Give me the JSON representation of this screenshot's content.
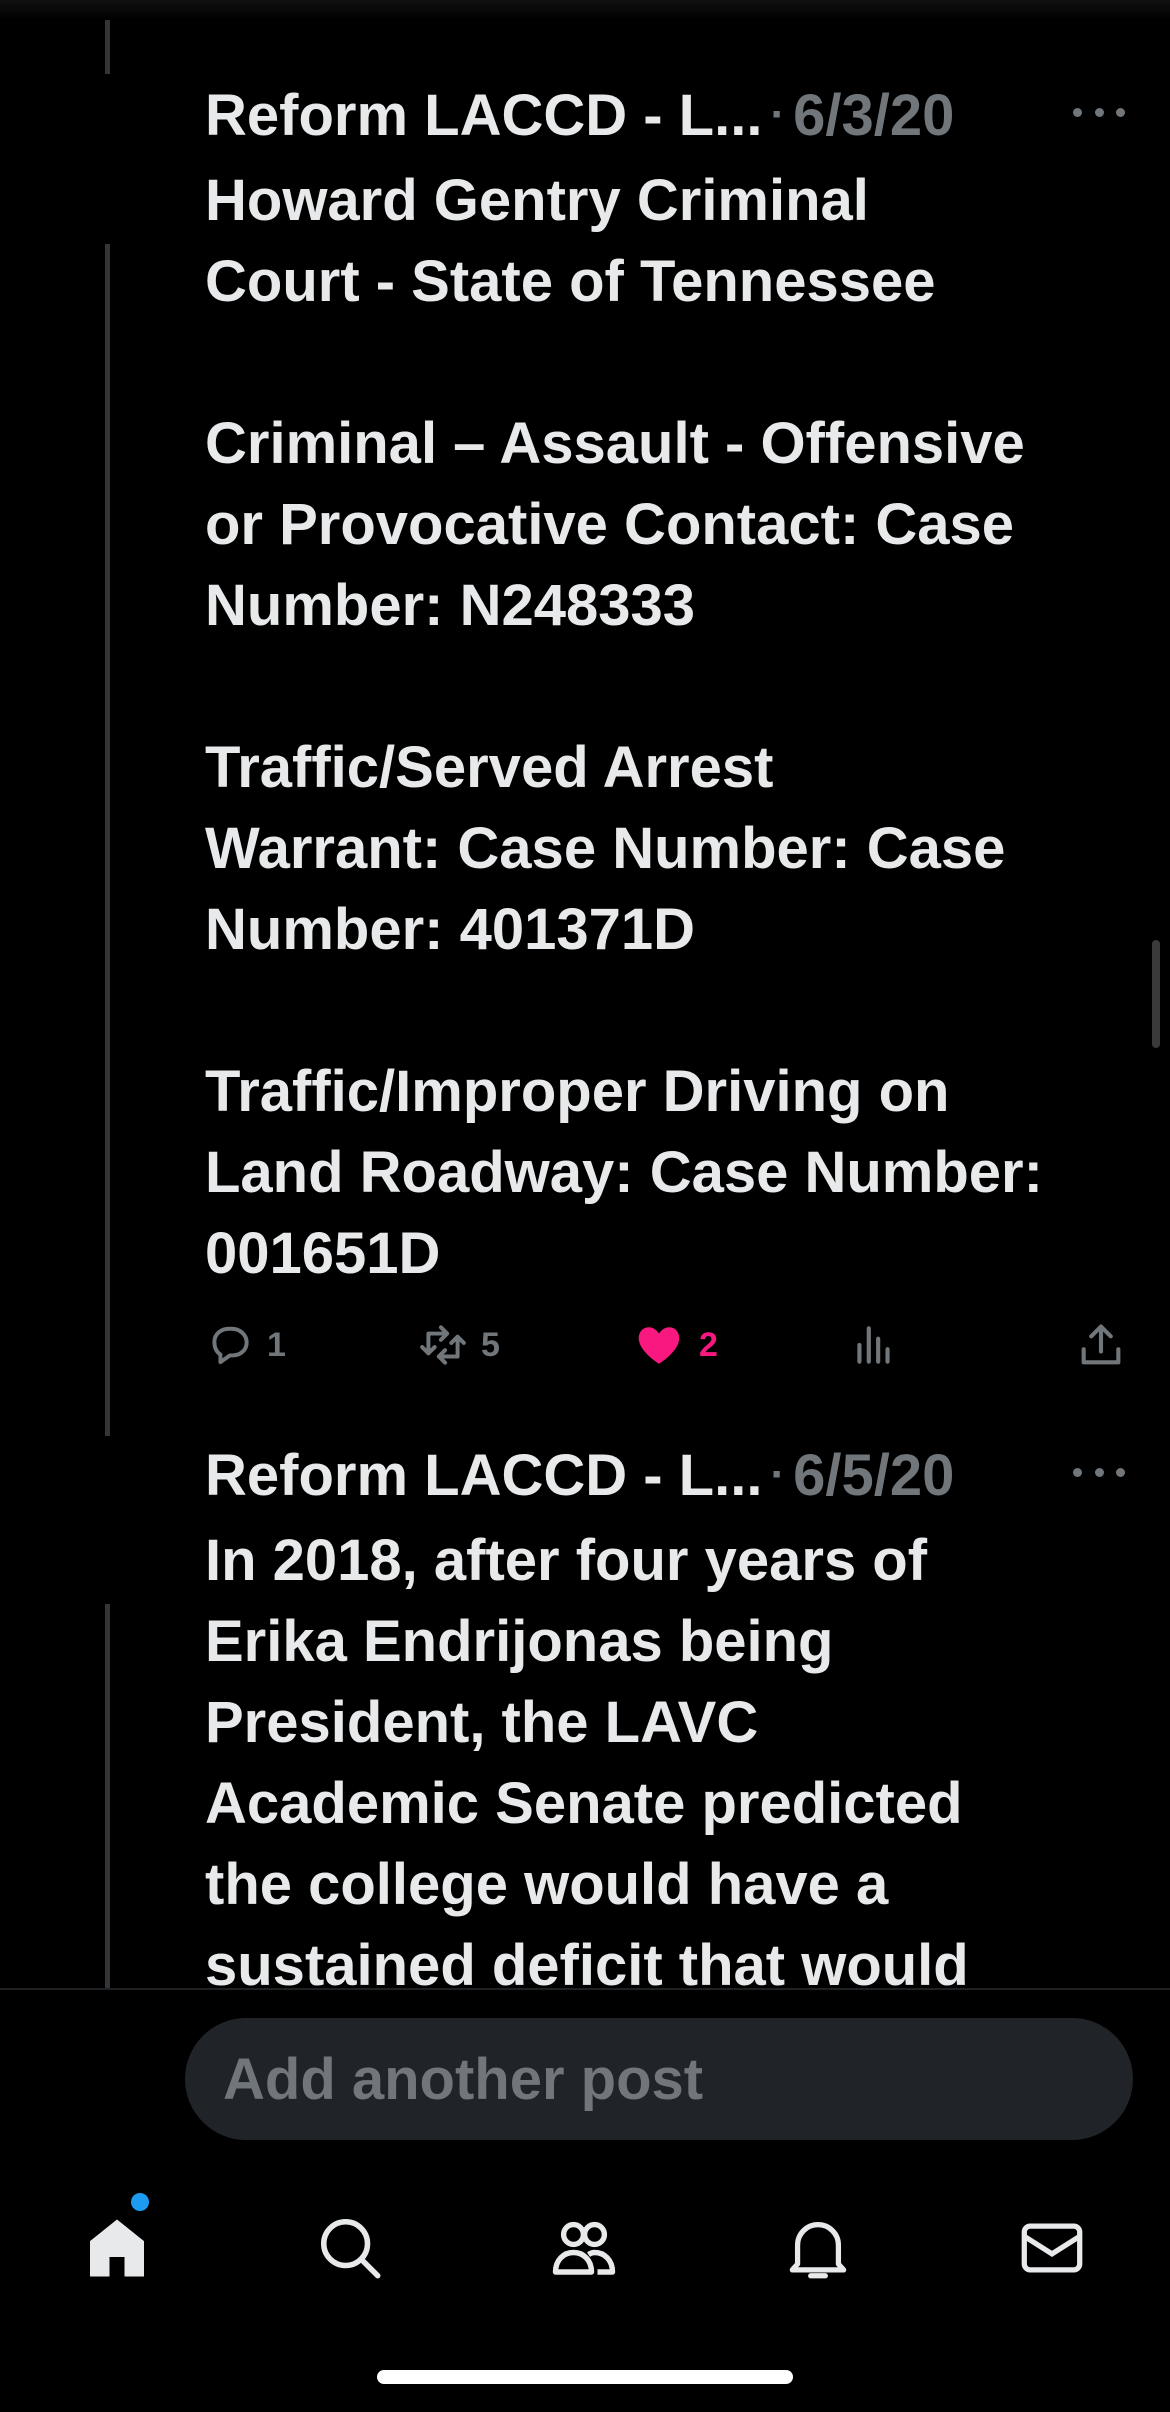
{
  "posts": [
    {
      "author": "Reform LACCD - L...",
      "separator": "·",
      "date": "6/3/20",
      "text": "Howard Gentry Criminal\nCourt - State of Tennessee\n\nCriminal – Assault - Offensive\nor Provocative Contact: Case\nNumber: N248333\n\nTraffic/Served Arrest\nWarrant: Case Number: Case\nNumber: 401371D\n\nTraffic/Improper Driving on\nLand Roadway: Case Number:\n001651D",
      "actions": {
        "replies": "1",
        "reposts": "5",
        "likes": "2",
        "liked": true
      }
    },
    {
      "author": "Reform LACCD - L...",
      "separator": "·",
      "date": "6/5/20",
      "text": "In 2018, after four years of\nErika Endrijonas being\nPresident, the LAVC\nAcademic Senate predicted\nthe college would have a\nsustained deficit that would"
    }
  ],
  "composer": {
    "placeholder": "Add another post"
  },
  "icons": {
    "reply": "reply-icon",
    "repost": "repost-icon",
    "like": "heart-icon",
    "views": "views-icon",
    "share": "share-icon",
    "more": "more-icon",
    "home": "home-icon",
    "search": "search-icon",
    "communities": "people-icon",
    "notifications": "bell-icon",
    "messages": "mail-icon"
  },
  "colors": {
    "background": "#000000",
    "text": "#e7e9ea",
    "muted": "#71767b",
    "like": "#f91880",
    "accent": "#1d9bf0"
  }
}
